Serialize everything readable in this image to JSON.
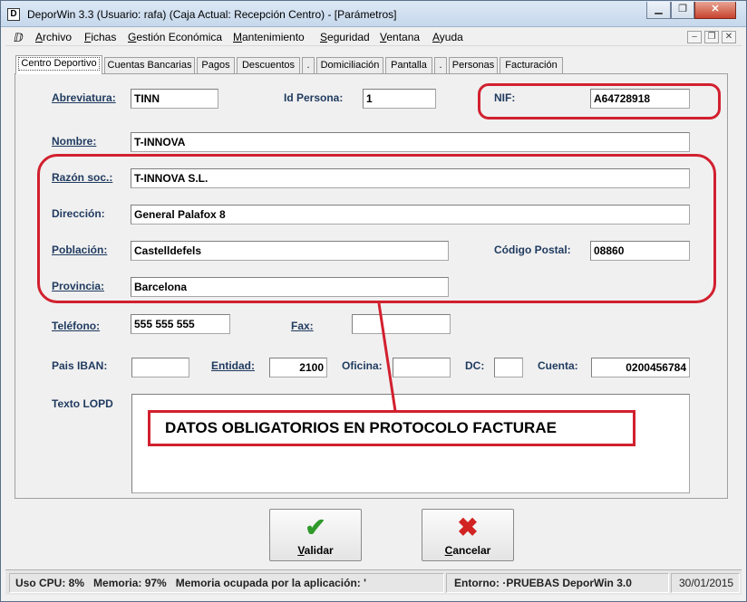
{
  "window": {
    "title": "DeporWin 3.3  (Usuario: rafa)  (Caja Actual: Recepción Centro) - [Parámetros]",
    "app_icon_letter": "D"
  },
  "menu": {
    "items": [
      "Archivo",
      "Fichas",
      "Gestión Económica",
      "Mantenimiento",
      "Seguridad",
      "Ventana",
      "Ayuda"
    ]
  },
  "tabs": [
    "Centro Deportivo",
    "Cuentas Bancarias",
    "Pagos",
    "Descuentos",
    ".",
    "Domiciliación",
    "Pantalla",
    ".",
    "Personas",
    "Facturación"
  ],
  "form": {
    "abreviatura": {
      "label": "Abreviatura:",
      "value": "TINN"
    },
    "id_persona": {
      "label": "Id Persona:",
      "value": "1"
    },
    "nif": {
      "label": "NIF:",
      "value": "A64728918"
    },
    "nombre": {
      "label": "Nombre:",
      "value": "T-INNOVA"
    },
    "razon_soc": {
      "label": "Razón soc.:",
      "value": "T-INNOVA S.L."
    },
    "direccion": {
      "label": "Dirección:",
      "value": "General Palafox 8"
    },
    "poblacion": {
      "label": "Población:",
      "value": "Castelldefels"
    },
    "codigo_postal": {
      "label": "Código Postal:",
      "value": "08860"
    },
    "provincia": {
      "label": "Provincia:",
      "value": "Barcelona"
    },
    "telefono": {
      "label": "Teléfono:",
      "value": "555 555 555"
    },
    "fax": {
      "label": "Fax:",
      "value": ""
    },
    "pais_iban": {
      "label": "Pais IBAN:",
      "value": ""
    },
    "entidad": {
      "label": "Entidad:",
      "value": "2100"
    },
    "oficina": {
      "label": "Oficina:",
      "value": ""
    },
    "dc": {
      "label": "DC:",
      "value": ""
    },
    "cuenta": {
      "label": "Cuenta:",
      "value": "0200456784"
    },
    "texto_lopd": {
      "label": "Texto LOPD",
      "value": ""
    }
  },
  "annotation": {
    "text": "DATOS OBLIGATORIOS EN PROTOCOLO FACTURAE",
    "color": "#d2202f"
  },
  "buttons": {
    "validar": "Validar",
    "cancelar": "Cancelar"
  },
  "status": {
    "cpu": "Uso CPU: 8%",
    "memoria": "Memoria: 97%",
    "memoria_app": "Memoria ocupada por la aplicación: '",
    "entorno": "Entorno: ·PRUEBAS DeporWin 3.0",
    "fecha": "30/01/2015"
  }
}
